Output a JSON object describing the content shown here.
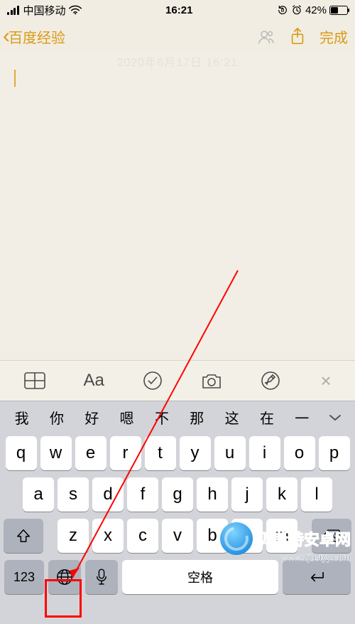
{
  "status": {
    "carrier": "中国移动",
    "time": "16:21",
    "battery_pct": "42%"
  },
  "nav": {
    "back_label": "百度经验",
    "done_label": "完成"
  },
  "note": {
    "date": "2020年6月17日 16:21"
  },
  "toolbar": {
    "table": "table-icon",
    "format_label": "Aa",
    "check": "check-icon",
    "camera": "camera-icon",
    "draw": "draw-icon",
    "close": "×"
  },
  "keyboard": {
    "candidates": [
      "我",
      "你",
      "好",
      "嗯",
      "不",
      "那",
      "这",
      "在",
      "一"
    ],
    "row1": [
      "q",
      "w",
      "e",
      "r",
      "t",
      "y",
      "u",
      "i",
      "o",
      "p"
    ],
    "row2": [
      "a",
      "s",
      "d",
      "f",
      "g",
      "h",
      "j",
      "k",
      "l"
    ],
    "row3": [
      "z",
      "x",
      "c",
      "v",
      "b",
      "n",
      "m"
    ],
    "numbers_label": "123",
    "space_label": "空格"
  },
  "watermark": {
    "name": "贝斯特安卓网",
    "url": "www.zjbstyy.com"
  }
}
